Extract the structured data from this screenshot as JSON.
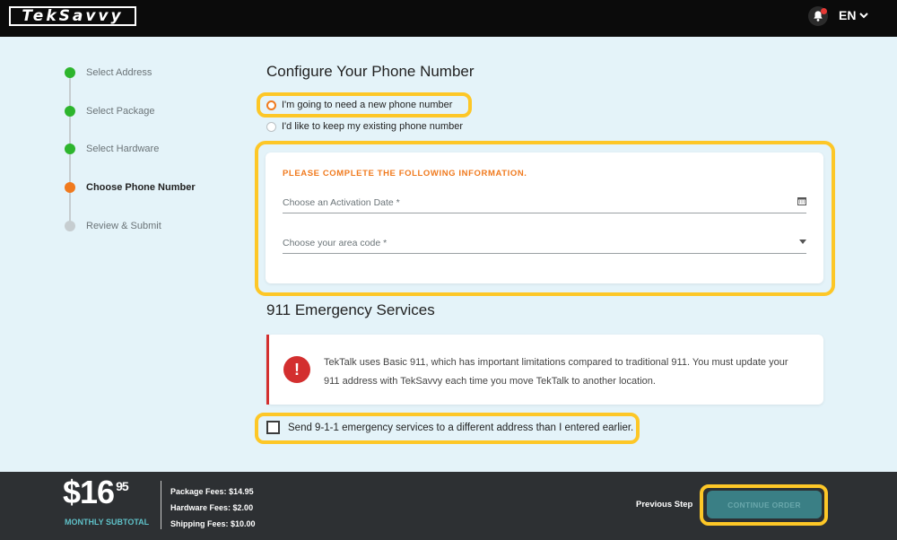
{
  "header": {
    "logo_text": "TekSavvy",
    "language": "EN"
  },
  "stepper": {
    "steps": [
      {
        "label": "Select Address",
        "state": "complete"
      },
      {
        "label": "Select Package",
        "state": "complete"
      },
      {
        "label": "Select Hardware",
        "state": "complete"
      },
      {
        "label": "Choose Phone Number",
        "state": "active"
      },
      {
        "label": "Review & Submit",
        "state": "pending"
      }
    ]
  },
  "phone": {
    "title": "Configure Your Phone Number",
    "option_new": "I'm going to need a new phone number",
    "option_keep": "I'd like to keep my existing phone number",
    "form_title": "PLEASE COMPLETE THE FOLLOWING INFORMATION.",
    "activation_placeholder": "Choose an Activation Date *",
    "area_code_placeholder": "Choose your area code *"
  },
  "emergency": {
    "title": "911 Emergency Services",
    "notice_line1": "TekTalk uses Basic 911, which has important limitations compared to traditional 911. You must update your",
    "notice_line2": "911 address with TekSavvy each time you move TekTalk to another location.",
    "checkbox_label": "Send 9-1-1 emergency services to a different address than I entered earlier."
  },
  "footer": {
    "price_dollars": "$16",
    "price_cents": "95",
    "subtotal_label": "MONTHLY SUBTOTAL",
    "fees": [
      {
        "label": "Package Fees:",
        "value": "$14.95"
      },
      {
        "label": "Hardware Fees:",
        "value": "$2.00"
      },
      {
        "label": "Shipping Fees:",
        "value": "$10.00"
      }
    ],
    "previous_step": "Previous Step",
    "continue_label": "CONTINUE ORDER"
  },
  "colors": {
    "complete": "#2db52d",
    "active": "#f07a1e",
    "pending": "#c6cdd0",
    "highlight": "#fdc727",
    "accent": "#f07a1e",
    "alert": "#d32f2f"
  }
}
